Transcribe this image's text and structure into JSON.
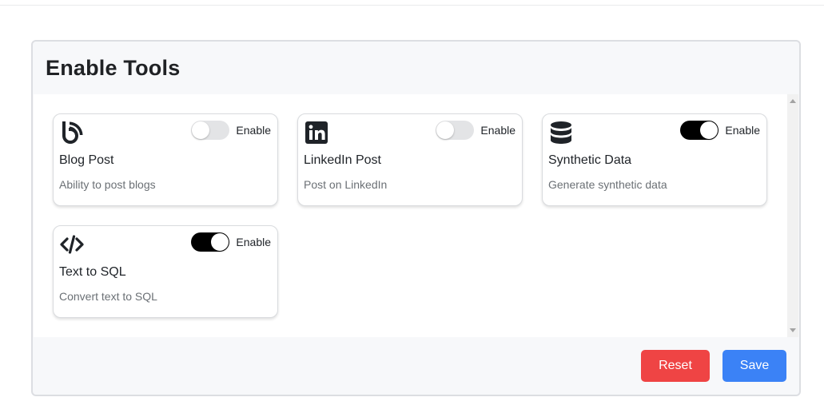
{
  "panel": {
    "title": "Enable Tools",
    "reset_label": "Reset",
    "save_label": "Save"
  },
  "tools": [
    {
      "icon": "blog-icon",
      "title": "Blog Post",
      "description": "Ability to post blogs",
      "toggle_label": "Enable",
      "enabled": false
    },
    {
      "icon": "linkedin-icon",
      "title": "LinkedIn Post",
      "description": "Post on LinkedIn",
      "toggle_label": "Enable",
      "enabled": false
    },
    {
      "icon": "database-icon",
      "title": "Synthetic Data",
      "description": "Generate synthetic data",
      "toggle_label": "Enable",
      "enabled": true
    },
    {
      "icon": "code-icon",
      "title": "Text to SQL",
      "description": "Convert text to SQL",
      "toggle_label": "Enable",
      "enabled": true
    }
  ],
  "colors": {
    "reset": "#ef4444",
    "save": "#3b82f6",
    "toggle_on": "#000000",
    "toggle_off": "#e3e4e6"
  }
}
